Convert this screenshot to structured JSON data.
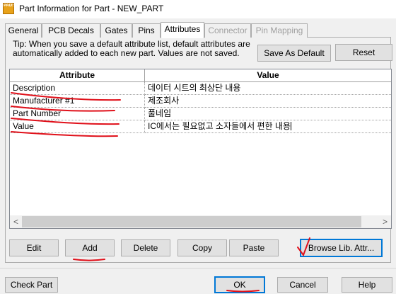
{
  "window": {
    "title": "Part Information for Part - NEW_PART",
    "icon_text": "PADS"
  },
  "tabs": [
    {
      "label": "General",
      "state": "normal"
    },
    {
      "label": "PCB Decals",
      "state": "normal"
    },
    {
      "label": "Gates",
      "state": "normal"
    },
    {
      "label": "Pins",
      "state": "normal"
    },
    {
      "label": "Attributes",
      "state": "active"
    },
    {
      "label": "Connector",
      "state": "disabled"
    },
    {
      "label": "Pin Mapping",
      "state": "disabled"
    }
  ],
  "tip": "Tip: When you save a default attribute list, default attributes are automatically added to each new part. Values are not saved.",
  "top_buttons": {
    "save_default": "Save As Default",
    "reset": "Reset"
  },
  "grid": {
    "columns": [
      "Attribute",
      "Value"
    ],
    "rows": [
      {
        "attribute": "Description",
        "value": "데이터 시트의 최상단 내용"
      },
      {
        "attribute": "Manufacturer #1",
        "value": "제조회사"
      },
      {
        "attribute": "Part Number",
        "value": "풀네임"
      },
      {
        "attribute": "Value",
        "value": "IC에서는 필요없고 소자들에서 편한 내용"
      }
    ],
    "scroll_left": "<",
    "scroll_right": ">"
  },
  "action_buttons": {
    "edit": "Edit",
    "add": "Add",
    "delete": "Delete",
    "copy": "Copy",
    "paste": "Paste",
    "browse": "Browse Lib. Attr..."
  },
  "bottom_buttons": {
    "check_part": "Check Part",
    "ok": "OK",
    "cancel": "Cancel",
    "help": "Help"
  },
  "colors": {
    "annotation_red": "#e0101a",
    "focus_blue": "#0078d7"
  }
}
